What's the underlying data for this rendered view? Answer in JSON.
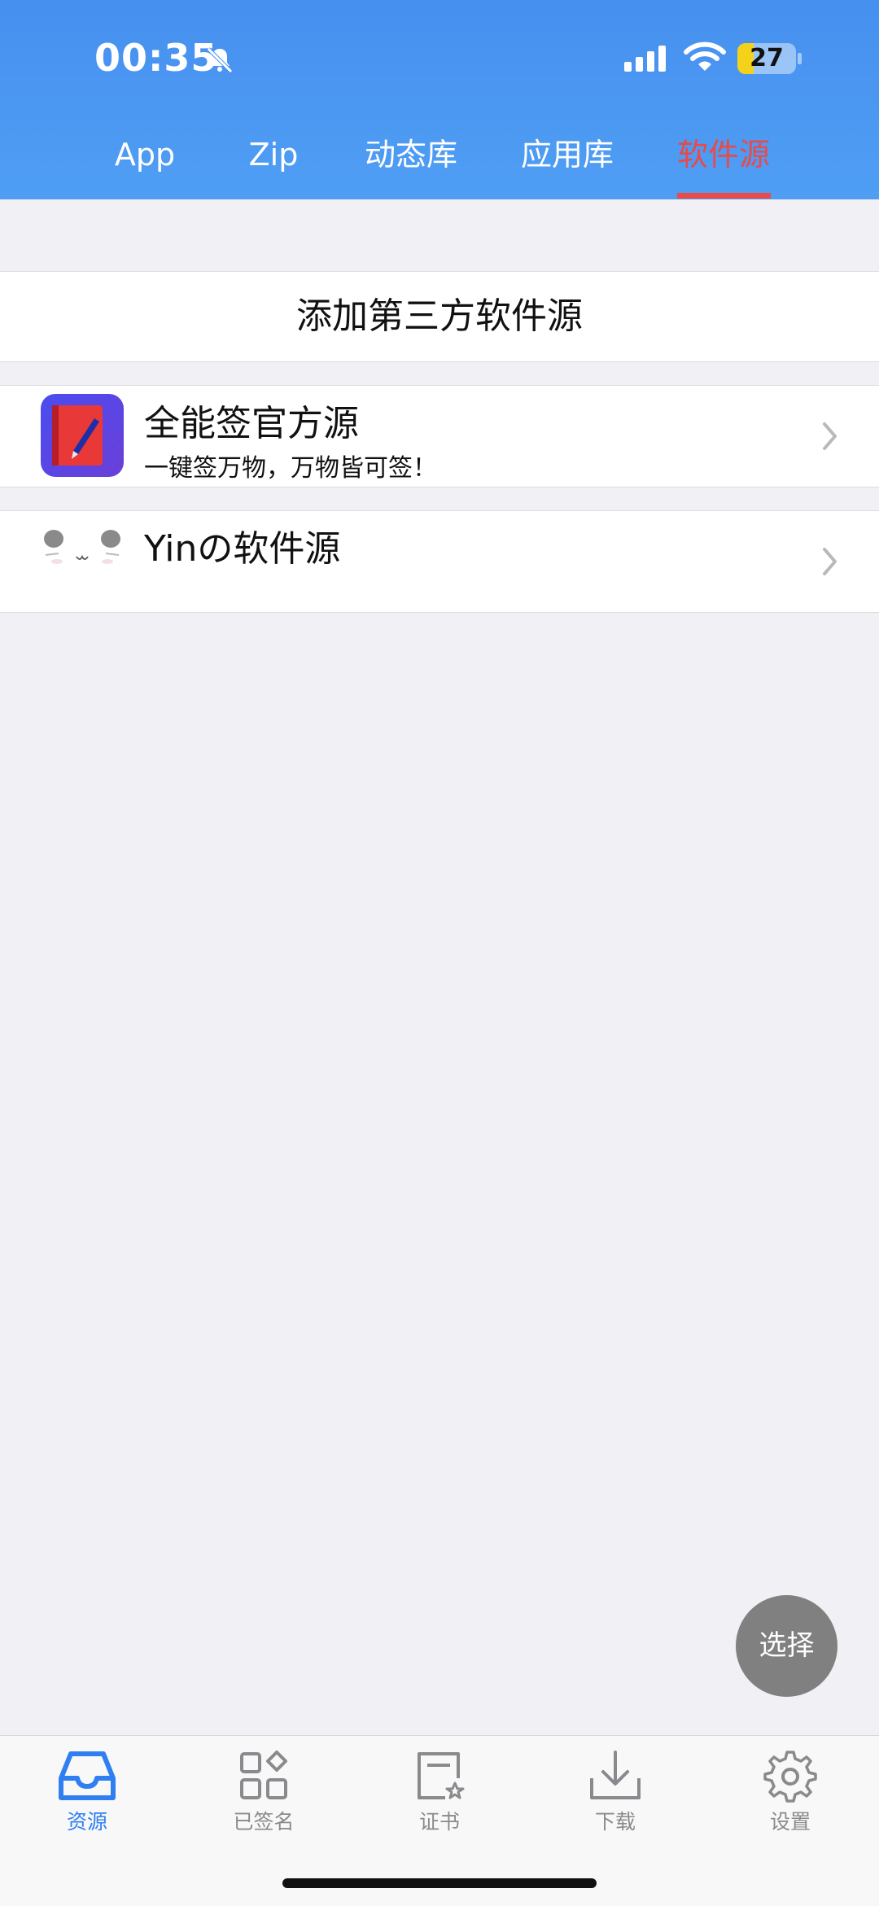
{
  "status": {
    "time": "00:35",
    "battery": "27"
  },
  "tabs": [
    {
      "label": "App"
    },
    {
      "label": "Zip"
    },
    {
      "label": "动态库"
    },
    {
      "label": "应用库"
    },
    {
      "label": "软件源"
    }
  ],
  "active_tab": "软件源",
  "add_source_label": "添加第三方软件源",
  "sources": [
    {
      "title": "全能签官方源",
      "subtitle": "一键签万物，万物皆可签！"
    },
    {
      "title": "Yinの软件源",
      "subtitle": ""
    }
  ],
  "fab_label": "选择",
  "bottom_tabs": [
    {
      "label": "资源",
      "icon": "inbox-icon"
    },
    {
      "label": "已签名",
      "icon": "grid-icon"
    },
    {
      "label": "证书",
      "icon": "certificate-icon"
    },
    {
      "label": "下载",
      "icon": "download-icon"
    },
    {
      "label": "设置",
      "icon": "gear-icon"
    }
  ],
  "colors": {
    "header": "#4a95f2",
    "accent_red": "#e94a4a",
    "accent_blue": "#2f7ff2",
    "fab": "#808080"
  }
}
